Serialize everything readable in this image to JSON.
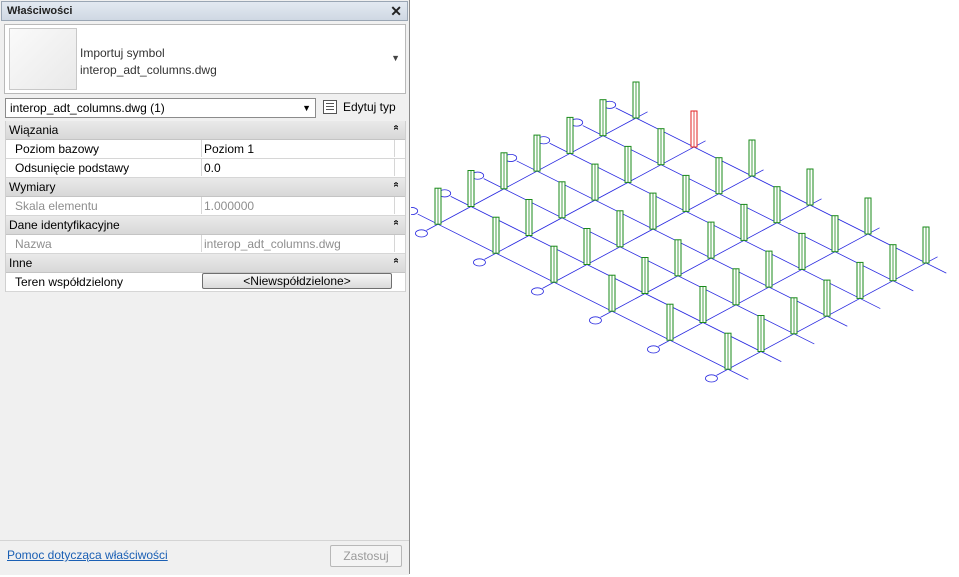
{
  "panel": {
    "title": "Właściwości",
    "close_glyph": "✕",
    "type_preview": {
      "family": "Importuj symbol",
      "type": "interop_adt_columns.dwg"
    },
    "instance_selector": "interop_adt_columns.dwg (1)",
    "edit_type_label": "Edytuj typ",
    "sections": [
      {
        "name": "Wiązania",
        "rows": [
          {
            "label": "Poziom bazowy",
            "value": "Poziom 1",
            "disabled": false
          },
          {
            "label": "Odsunięcie podstawy",
            "value": "0.0",
            "disabled": false
          }
        ]
      },
      {
        "name": "Wymiary",
        "rows": [
          {
            "label": "Skala elementu",
            "value": "1.000000",
            "disabled": true
          }
        ]
      },
      {
        "name": "Dane identyfikacyjne",
        "rows": [
          {
            "label": "Nazwa",
            "value": "interop_adt_columns.dwg",
            "disabled": true
          }
        ]
      },
      {
        "name": "Inne",
        "rows": [
          {
            "label": "Teren współdzielony",
            "value": "<Niewspółdzielone>",
            "button": true
          }
        ]
      }
    ],
    "help_link": "Pomoc dotycząca właściwości",
    "apply_button": "Zastosuj"
  },
  "viewport": {
    "grid_color": "#2a2ae0",
    "column_color": "#1a8a1a",
    "selected_column_color": "#e02020",
    "columns_per_row": 6,
    "rows_of_columns": 7,
    "selected_column": {
      "row": 0,
      "col": 1
    }
  }
}
